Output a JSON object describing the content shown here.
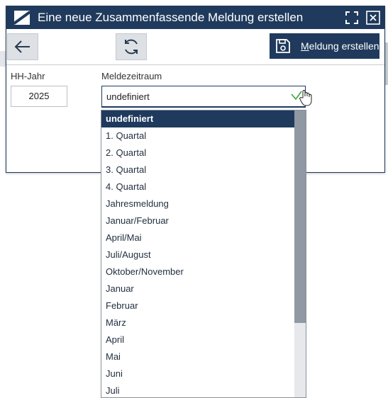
{
  "dialog": {
    "title": "Eine neue Zusammenfassende Meldung erstellen",
    "icons": {
      "logo": "app-logo",
      "maximize": "maximize-icon",
      "close": "close-icon"
    }
  },
  "toolbar": {
    "back_icon": "arrow-left-icon",
    "refresh_icon": "refresh-icon",
    "create_icon": "save-icon",
    "create_label": "Meldung erstellen"
  },
  "form": {
    "year_label": "HH-Jahr",
    "year_value": "2025",
    "period_label": "Meldezeitraum",
    "period_value": "undefiniert"
  },
  "dropdown": {
    "selected_index": 0,
    "options": [
      "undefiniert",
      "1. Quartal",
      "2. Quartal",
      "3. Quartal",
      "4. Quartal",
      "Jahresmeldung",
      "Januar/Februar",
      "April/Mai",
      "Juli/August",
      "Oktober/November",
      "Januar",
      "Februar",
      "März",
      "April",
      "Mai",
      "Juni",
      "Juli"
    ]
  },
  "colors": {
    "primary": "#1f3a5c",
    "accent_check": "#3aa53a"
  }
}
